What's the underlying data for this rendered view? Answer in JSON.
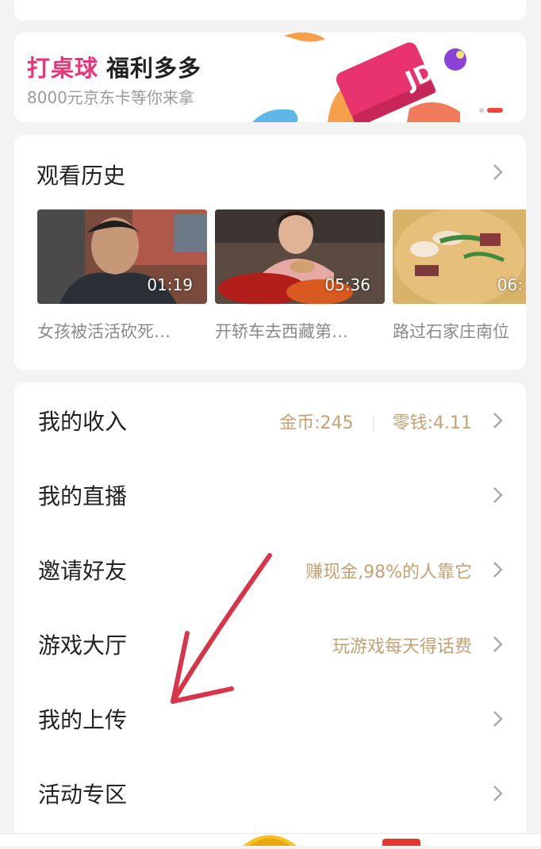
{
  "banner": {
    "title_pink": "打桌球",
    "title_dark": "福利多多",
    "subtitle": "8000元京东卡等你来拿",
    "card_text": "JD"
  },
  "history": {
    "title": "观看历史",
    "videos": [
      {
        "duration": "01:19",
        "title": "女孩被活活砍死…"
      },
      {
        "duration": "05:36",
        "title": "开轿车去西藏第…"
      },
      {
        "duration": "06:",
        "title": "路过石家庄南位"
      }
    ]
  },
  "menu": {
    "income": {
      "label": "我的收入",
      "coins": "金币:245",
      "change": "零钱:4.11"
    },
    "live": {
      "label": "我的直播"
    },
    "invite": {
      "label": "邀请好友",
      "note": "赚现金,98%的人靠它"
    },
    "games": {
      "label": "游戏大厅",
      "note": "玩游戏每天得话费"
    },
    "upload": {
      "label": "我的上传"
    },
    "events": {
      "label": "活动专区"
    }
  },
  "colors": {
    "accent_pink": "#e8347b",
    "gold_text": "#c3a273",
    "annotation_red": "#d8344a"
  },
  "icons": [
    "chevron-right-icon"
  ]
}
